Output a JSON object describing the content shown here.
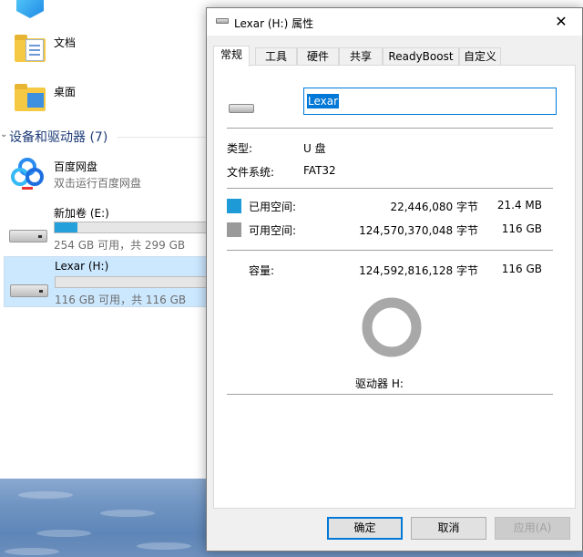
{
  "explorer": {
    "folders": [
      {
        "label": "文档"
      },
      {
        "label": "桌面"
      }
    ],
    "section_title": "设备和驱动器 (7)",
    "baidu": {
      "name": "百度网盘",
      "subtitle": "双击运行百度网盘"
    },
    "drives": [
      {
        "name": "新加卷 (E:)",
        "usage": "254 GB 可用，共 299 GB",
        "used_fraction": 0.15
      },
      {
        "name": "Lexar (H:)",
        "usage": "116 GB 可用，共 116 GB",
        "used_fraction": 0.0
      }
    ],
    "right_partial": [
      "共",
      "G",
      "共"
    ]
  },
  "dialog": {
    "title": "Lexar (H:) 属性",
    "close_symbol": "✕",
    "tabs": [
      {
        "label": "常规",
        "active": true
      },
      {
        "label": "工具",
        "active": false
      },
      {
        "label": "硬件",
        "active": false
      },
      {
        "label": "共享",
        "active": false
      },
      {
        "label": "ReadyBoost",
        "active": false
      },
      {
        "label": "自定义",
        "active": false
      }
    ],
    "name_value": "Lexar",
    "type_label": "类型:",
    "type_value": "U 盘",
    "fs_label": "文件系统:",
    "fs_value": "FAT32",
    "used": {
      "label": "已用空间:",
      "bytes": "22,446,080 字节",
      "size": "21.4 MB",
      "color": "#1e9bd7"
    },
    "free": {
      "label": "可用空间:",
      "bytes": "124,570,370,048 字节",
      "size": "116 GB",
      "color": "#9a9a9a"
    },
    "capacity": {
      "label": "容量:",
      "bytes": "124,592,816,128 字节",
      "size": "116 GB"
    },
    "used_fraction": 0.0002,
    "drive_caption": "驱动器 H:",
    "buttons": {
      "ok": "确定",
      "cancel": "取消",
      "apply": "应用(A)"
    }
  }
}
